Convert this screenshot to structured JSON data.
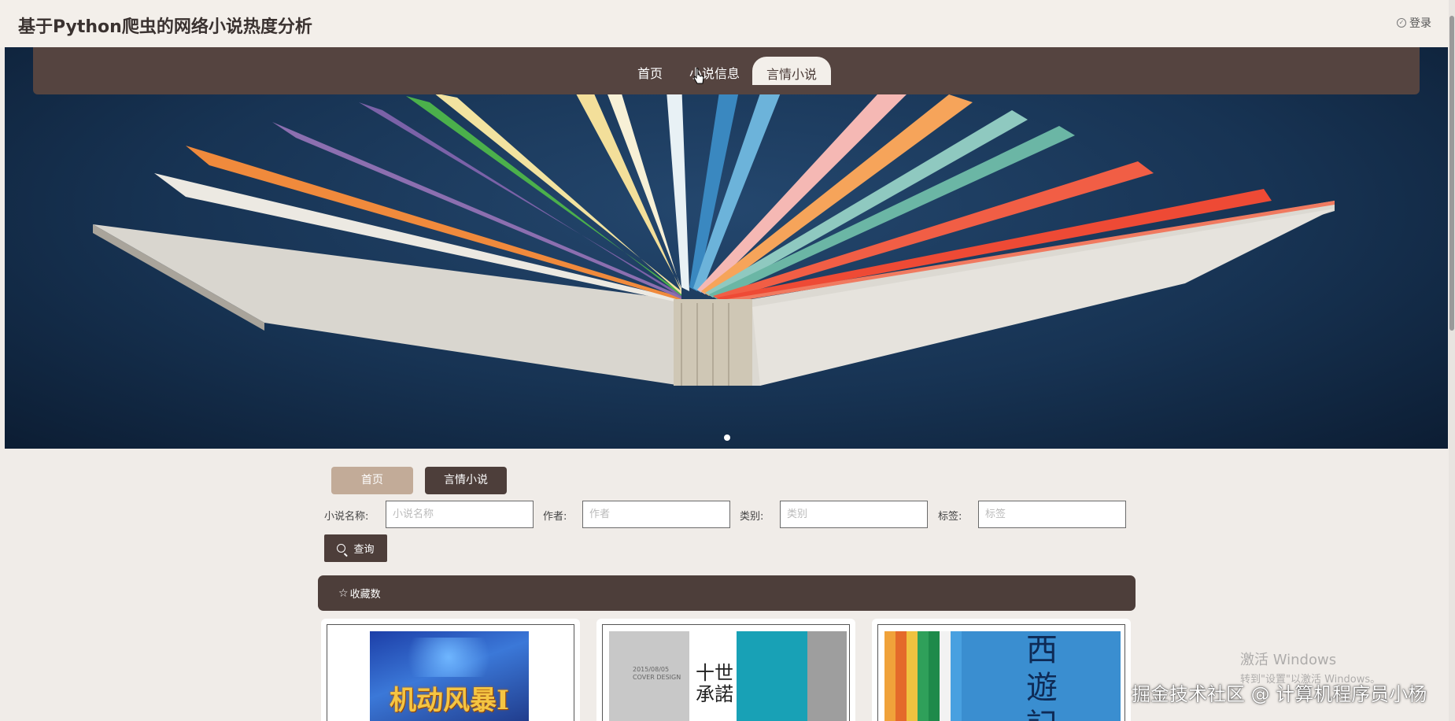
{
  "header": {
    "site_title": "基于Python爬虫的网络小说热度分析",
    "login_label": "登录",
    "login_icon": "user-circle-icon"
  },
  "nav": {
    "items": [
      {
        "label": "首页",
        "active": false
      },
      {
        "label": "小说信息",
        "active": false
      },
      {
        "label": "言情小说",
        "active": true
      }
    ]
  },
  "banner": {
    "slide_count": 1,
    "active_slide": 1
  },
  "subtabs": {
    "home_label": "首页",
    "current_label": "言情小说"
  },
  "search": {
    "name_label": "小说名称:",
    "name_placeholder": "小说名称",
    "author_label": "作者:",
    "author_placeholder": "作者",
    "category_label": "类别:",
    "category_placeholder": "类别",
    "tag_label": "标签:",
    "tag_placeholder": "标签",
    "button_label": "查询"
  },
  "sort": {
    "label": "收藏数",
    "icon": "star-outline-icon"
  },
  "cards": [
    {
      "cover_text": "机动风暴I"
    },
    {
      "cover_text": "十世承諾",
      "cover_small": "2015/08/05 COVER DESIGN"
    },
    {
      "cover_text": "西遊記"
    }
  ],
  "colors": {
    "nav_bg": "#554440",
    "accent_dark": "#4d3e3a",
    "accent_light": "#c2ab98",
    "page_bg": "#f0ece8"
  },
  "watermarks": {
    "windows_title": "激活 Windows",
    "windows_sub": "转到\"设置\"以激活 Windows。",
    "site": "掘金技术社区 @ 计算机程序员小杨"
  }
}
